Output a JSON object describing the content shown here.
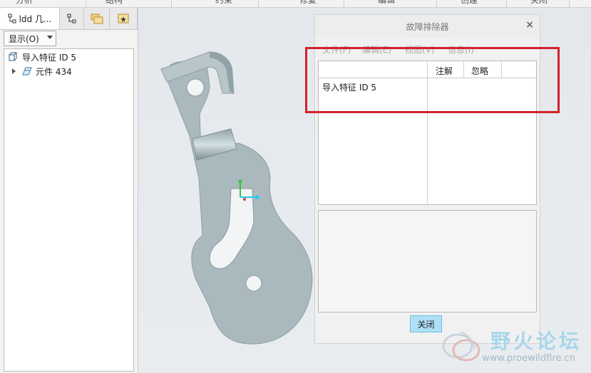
{
  "ribbon": {
    "tabs": [
      "分析",
      "结构",
      "约束",
      "修复",
      "编辑",
      "创建",
      "关闭"
    ]
  },
  "left_panel": {
    "tab_label": "ldd 几...",
    "show_button": "显示(O)",
    "tree": [
      {
        "label": "导入特征 ID 5"
      },
      {
        "label": "元件 434"
      }
    ]
  },
  "dialog": {
    "title": "故障排除器",
    "close_symbol": "×",
    "menus": [
      "文件(F)",
      "编辑(E)",
      "视图(V)",
      "信息(I)"
    ],
    "columns": [
      "注解",
      "忽略"
    ],
    "rows": [
      {
        "name": "导入特征 ID 5",
        "note": "",
        "ignore": ""
      }
    ],
    "close_button": "关闭"
  },
  "watermark": {
    "title": "野火论坛",
    "url": "www.proewildfire.cn"
  },
  "colors": {
    "highlight": "#d3212c",
    "part": "#a9b9bd",
    "button": "#aee0f6"
  }
}
